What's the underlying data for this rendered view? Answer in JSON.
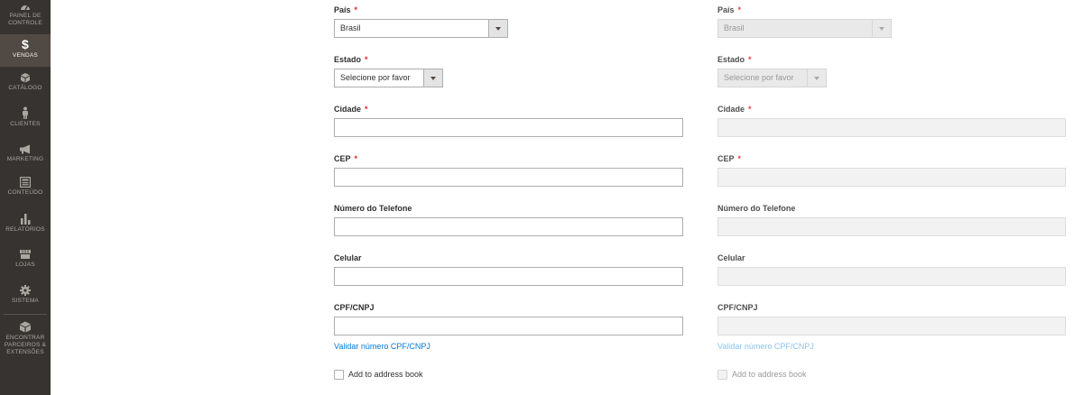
{
  "sidebar": {
    "items": [
      {
        "label": "PAINEL DE CONTROLE",
        "icon": "dashboard-icon"
      },
      {
        "label": "VENDAS",
        "icon": "dollar-icon",
        "active": true
      },
      {
        "label": "CATÁLOGO",
        "icon": "catalog-box-icon"
      },
      {
        "label": "CLIENTES",
        "icon": "customer-person-icon"
      },
      {
        "label": "MARKETING",
        "icon": "megaphone-icon"
      },
      {
        "label": "CONTEÚDO",
        "icon": "content-layout-icon"
      },
      {
        "label": "RELATÓRIOS",
        "icon": "bar-chart-icon"
      },
      {
        "label": "LOJAS",
        "icon": "store-icon"
      },
      {
        "label": "SISTEMA",
        "icon": "gear-icon"
      },
      {
        "label": "ENCONTRAR PARCEIROS & EXTENSÕES",
        "icon": "partners-box-icon"
      }
    ],
    "colors": {
      "background": "#373330",
      "active": "#514943",
      "text": "#aaa6a0"
    }
  },
  "form": {
    "country": {
      "label": "País",
      "value": "Brasil"
    },
    "state": {
      "label": "Estado",
      "value": "Selecione por favor"
    },
    "city": {
      "label": "Cidade",
      "value": ""
    },
    "zip": {
      "label": "CEP",
      "value": ""
    },
    "phone": {
      "label": "Número do Telefone",
      "value": ""
    },
    "mobile": {
      "label": "Celular",
      "value": ""
    },
    "cpf": {
      "label": "CPF/CNPJ",
      "value": ""
    },
    "required_mark": "*",
    "validate_link": "Validar número CPF/CNPJ",
    "address_book": "Add to address book"
  },
  "colors": {
    "required": "#e22626",
    "link": "#007bdb",
    "link_disabled": "#8cc4ee"
  }
}
